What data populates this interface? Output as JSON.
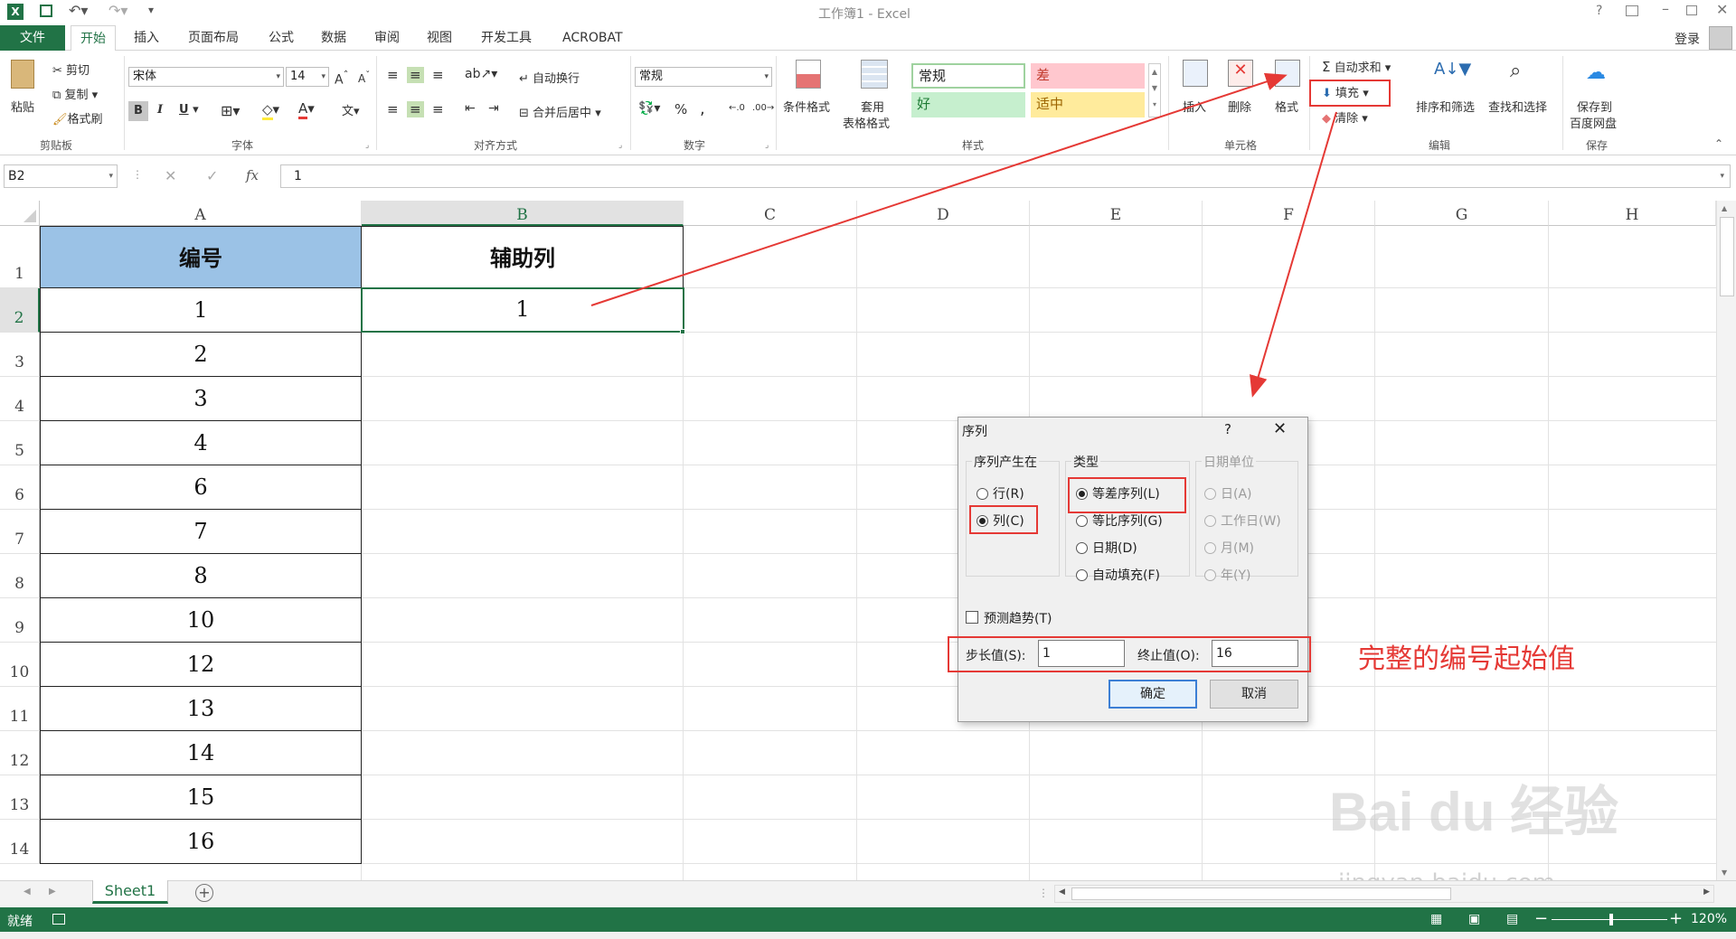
{
  "window": {
    "title": "工作簿1 - Excel",
    "help": "?",
    "login": "登录"
  },
  "tabs": [
    "文件",
    "开始",
    "插入",
    "页面布局",
    "公式",
    "数据",
    "审阅",
    "视图",
    "开发工具",
    "ACROBAT"
  ],
  "ribbon": {
    "clipboard": {
      "paste": "粘贴",
      "cut": "剪切",
      "copy": "复制",
      "format_painter": "格式刷",
      "label": "剪贴板"
    },
    "font": {
      "name": "宋体",
      "size": "14",
      "bold": "B",
      "italic": "I",
      "underline": "U",
      "label": "字体"
    },
    "alignment": {
      "wrap": "自动换行",
      "merge": "合并后居中",
      "label": "对齐方式"
    },
    "number": {
      "format": "常规",
      "percent": "%",
      "comma": ",",
      "label": "数字"
    },
    "styles": {
      "conditional": "条件格式",
      "table_fmt_1": "套用",
      "table_fmt_2": "表格格式",
      "normal": "常规",
      "bad": "差",
      "good": "好",
      "neutral": "适中",
      "label": "样式"
    },
    "cells": {
      "insert": "插入",
      "delete": "删除",
      "format": "格式",
      "label": "单元格"
    },
    "editing": {
      "autosum": "自动求和",
      "fill": "填充",
      "clear": "清除",
      "sort": "排序和筛选",
      "find": "查找和选择",
      "label": "编辑"
    },
    "save": {
      "line1": "保存到",
      "line2": "百度网盘",
      "label": "保存"
    }
  },
  "formula_bar": {
    "name_box": "B2",
    "fx": "fx",
    "value": "1"
  },
  "columns": [
    "A",
    "B",
    "C",
    "D",
    "E",
    "F",
    "G",
    "H"
  ],
  "rows": [
    "1",
    "2",
    "3",
    "4",
    "5",
    "6",
    "7",
    "8",
    "9",
    "10",
    "11",
    "12",
    "13",
    "14"
  ],
  "cells": {
    "a_header": "编号",
    "b_header": "辅助列",
    "a_values": [
      "1",
      "2",
      "3",
      "4",
      "6",
      "7",
      "8",
      "10",
      "12",
      "13",
      "14",
      "15",
      "16"
    ],
    "b2": "1"
  },
  "sheet_tab": "Sheet1",
  "status": {
    "ready": "就绪",
    "zoom": "120%"
  },
  "dialog": {
    "title": "序列",
    "help": "?",
    "series_in_label": "序列产生在",
    "row": "行(R)",
    "column": "列(C)",
    "type_label": "类型",
    "linear": "等差序列(L)",
    "growth": "等比序列(G)",
    "date": "日期(D)",
    "autofill": "自动填充(F)",
    "date_unit_label": "日期单位",
    "day": "日(A)",
    "weekday": "工作日(W)",
    "month": "月(M)",
    "year": "年(Y)",
    "trend": "预测趋势(T)",
    "step_label": "步长值(S):",
    "step_value": "1",
    "stop_label": "终止值(O):",
    "stop_value": "16",
    "ok": "确定",
    "cancel": "取消"
  },
  "annotation": {
    "text": "完整的编号起始值"
  },
  "watermark": {
    "brand": "Bai du 经验",
    "url": "jingyan.baidu.com"
  },
  "colors": {
    "excel_green": "#217346",
    "header_fill": "#9bc2e6",
    "annotation_red": "#e53935"
  }
}
